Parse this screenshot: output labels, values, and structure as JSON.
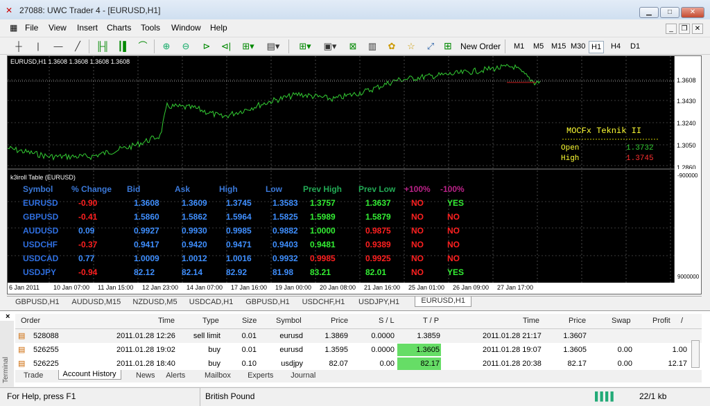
{
  "app": {
    "title": "27088: UWC Trader 4 - [EURUSD,H1]"
  },
  "menu": [
    "File",
    "View",
    "Insert",
    "Charts",
    "Tools",
    "Window",
    "Help"
  ],
  "toolbar": {
    "new_order": "New Order",
    "timeframes": [
      "M1",
      "M5",
      "M15",
      "M30",
      "H1",
      "H4",
      "D1"
    ],
    "active_timeframe": "H1"
  },
  "chart": {
    "header": "EURUSD,H1  1.3608 1.3608 1.3608 1.3608",
    "price_axis": [
      "1.3608",
      "1.3430",
      "1.3240",
      "1.3050",
      "1.2860"
    ],
    "time_axis": [
      "6 Jan 2011",
      "10 Jan 07:00",
      "11 Jan 15:00",
      "12 Jan 23:00",
      "14 Jan 07:00",
      "17 Jan 16:00",
      "19 Jan 00:00",
      "20 Jan 08:00",
      "21 Jan 16:00",
      "25 Jan 01:00",
      "26 Jan 09:00",
      "27 Jan 17:00"
    ],
    "line_color": "#33cc33",
    "info_box": {
      "title": "MOCFx Teknik II",
      "open_label": "Open",
      "open_value": "1.3732",
      "high_label": "High",
      "high_value": "1.3745"
    },
    "indicator_title": "k3iroll Table (EURUSD)",
    "indicator_scale_top": "-900000",
    "indicator_scale_bottom": "9000000"
  },
  "table": {
    "headers": [
      "Symbol",
      "% Change",
      "Bid",
      "Ask",
      "High",
      "Low",
      "Prev High",
      "Prev Low",
      "+100%",
      "-100%"
    ],
    "rows": [
      [
        "EURUSD",
        "-0.90",
        "1.3608",
        "1.3609",
        "1.3745",
        "1.3583",
        "1.3757",
        "1.3637",
        "NO",
        "YES"
      ],
      [
        "GBPUSD",
        "-0.41",
        "1.5860",
        "1.5862",
        "1.5964",
        "1.5825",
        "1.5989",
        "1.5879",
        "NO",
        "NO"
      ],
      [
        "AUDUSD",
        "0.09",
        "0.9927",
        "0.9930",
        "0.9985",
        "0.9882",
        "1.0000",
        "0.9875",
        "NO",
        "NO"
      ],
      [
        "USDCHF",
        "-0.37",
        "0.9417",
        "0.9420",
        "0.9471",
        "0.9403",
        "0.9481",
        "0.9389",
        "NO",
        "NO"
      ],
      [
        "USDCAD",
        "0.77",
        "1.0009",
        "1.0012",
        "1.0016",
        "0.9932",
        "0.9985",
        "0.9925",
        "NO",
        "NO"
      ],
      [
        "USDJPY",
        "-0.94",
        "82.12",
        "82.14",
        "82.92",
        "81.98",
        "83.21",
        "82.01",
        "NO",
        "YES"
      ]
    ],
    "colors": {
      "symbol": "#2f6fe0",
      "neg": "#ff2020",
      "pos": "#3f8fff",
      "price": "#3f8fff",
      "green": "#33ee33",
      "red": "#ff2020",
      "yes": "#33ee33"
    }
  },
  "chart_tabs": [
    "GBPUSD,H1",
    "AUDUSD,M15",
    "NZDUSD,M5",
    "USDCAD,H1",
    "GBPUSD,H1",
    "USDCHF,H1",
    "USDJPY,H1",
    "EURUSD,H1"
  ],
  "terminal": {
    "side_label": "Terminal",
    "headers": [
      "Order",
      "Time",
      "Type",
      "Size",
      "Symbol",
      "Price",
      "S / L",
      "T / P",
      "Time",
      "Price",
      "Swap",
      "Profit"
    ],
    "rows": [
      [
        "528088",
        "2011.01.28 12:26",
        "sell limit",
        "0.01",
        "eurusd",
        "1.3869",
        "0.0000",
        "1.3859",
        "2011.01.28 21:17",
        "1.3607",
        "",
        ""
      ],
      [
        "526255",
        "2011.01.28 19:02",
        "buy",
        "0.01",
        "eurusd",
        "1.3595",
        "0.0000",
        "1.3605",
        "2011.01.28 19:07",
        "1.3605",
        "0.00",
        "1.00"
      ],
      [
        "526225",
        "2011.01.28 18:40",
        "buy",
        "0.10",
        "usdjpy",
        "82.07",
        "0.00",
        "82.17",
        "2011.01.28 20:38",
        "82.17",
        "0.00",
        "12.17"
      ]
    ],
    "tabs": [
      "Trade",
      "Account History",
      "News",
      "Alerts",
      "Mailbox",
      "Experts",
      "Journal"
    ],
    "active_tab": "Account History"
  },
  "status": {
    "help": "For Help, press F1",
    "profile": "British Pound",
    "traffic": "22/1 kb"
  }
}
